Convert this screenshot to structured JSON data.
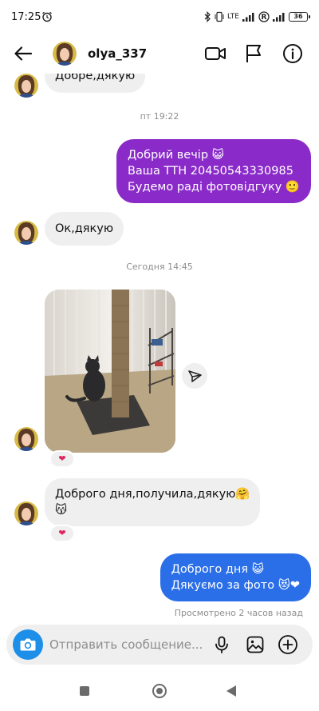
{
  "status_bar": {
    "time": "17:25",
    "network": "LTE",
    "battery": "36",
    "icons": [
      "alarm-icon",
      "bluetooth-icon",
      "vibrate-icon",
      "signal-icon",
      "registered-icon",
      "battery-icon"
    ]
  },
  "header": {
    "username": "olya_337",
    "icons": [
      "back-arrow-icon",
      "video-call-icon",
      "flag-icon",
      "info-icon"
    ]
  },
  "messages": {
    "m1": {
      "text": "Добре,дякую"
    },
    "sep1": "пт 19:22",
    "m2": {
      "line1": "Добрий вечір 😺",
      "line2": "Ваша ТТН 20450543330985",
      "line3": "Будемо раді фотовідгуку 🙂"
    },
    "m3": {
      "text": "Ок,дякую"
    },
    "sep2": "Сегодня 14:45",
    "m4_reaction": "❤",
    "m5": {
      "line1": "Доброго дня,получила,дякую🤗",
      "line2": "😽"
    },
    "m5_reaction": "❤",
    "m6": {
      "line1": "Доброго дня 😺",
      "line2": "Дякуємо за фото 😻❤"
    },
    "seen": "Просмотрено 2 часов назад"
  },
  "composer": {
    "placeholder": "Отправить сообщение...",
    "icons": [
      "camera-icon",
      "microphone-icon",
      "gallery-icon",
      "plus-icon"
    ]
  },
  "navigation": {
    "icons": [
      "recents-icon",
      "home-icon",
      "back-icon"
    ]
  },
  "colors": {
    "purple_bubble": "#8a2bc9",
    "blue_bubble": "#2a6ee8",
    "incoming_bubble": "#efefef",
    "camera_button": "#1d8fe8"
  }
}
